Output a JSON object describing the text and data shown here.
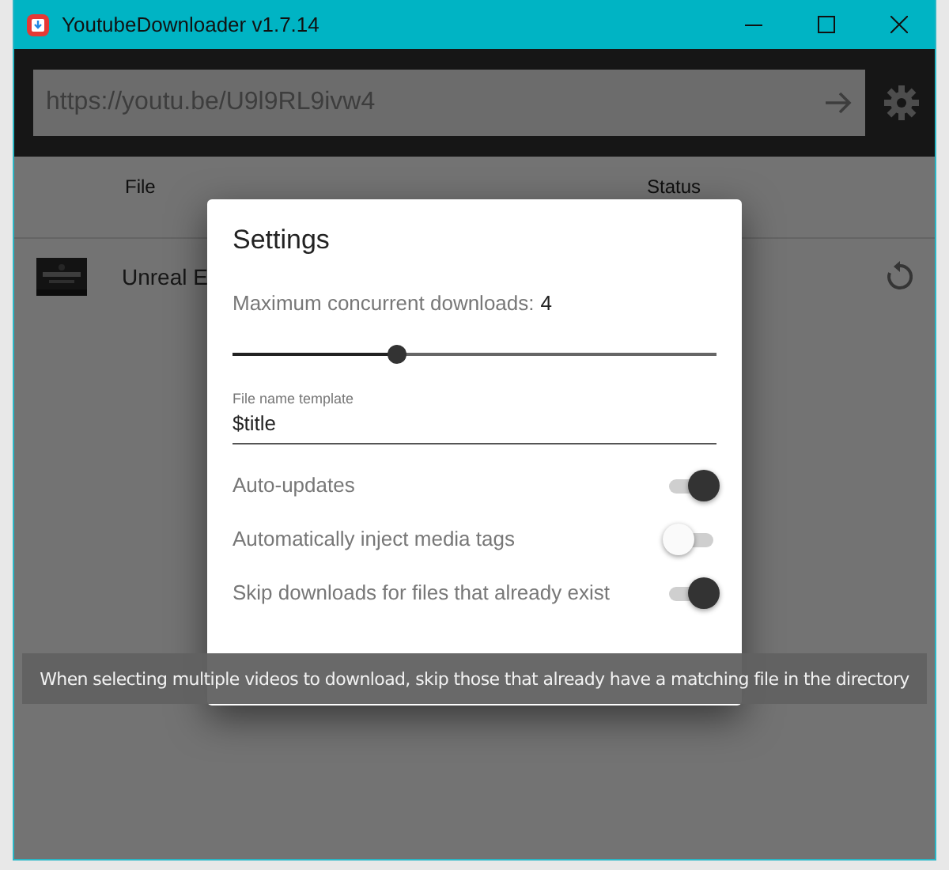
{
  "window": {
    "title": "YoutubeDownloader v1.7.14"
  },
  "url_bar": {
    "value": "https://youtu.be/U9l9RL9ivw4"
  },
  "table": {
    "columns": [
      "File",
      "Status"
    ],
    "rows": [
      {
        "title": "Unreal E"
      }
    ]
  },
  "settings_dialog": {
    "title": "Settings",
    "slider": {
      "label": "Maximum concurrent downloads:",
      "reading": "4",
      "level": 0.34
    },
    "field": {
      "label": "File name template",
      "value": "$title"
    },
    "toggles": [
      {
        "label": "Auto-updates",
        "on": true
      },
      {
        "label": "Automatically inject media tags",
        "on": false
      },
      {
        "label": "Skip downloads for files that already exist",
        "on": true
      }
    ]
  },
  "tooltip": {
    "text": "When selecting multiple videos to download, skip those that already have a matching file in the directory"
  }
}
